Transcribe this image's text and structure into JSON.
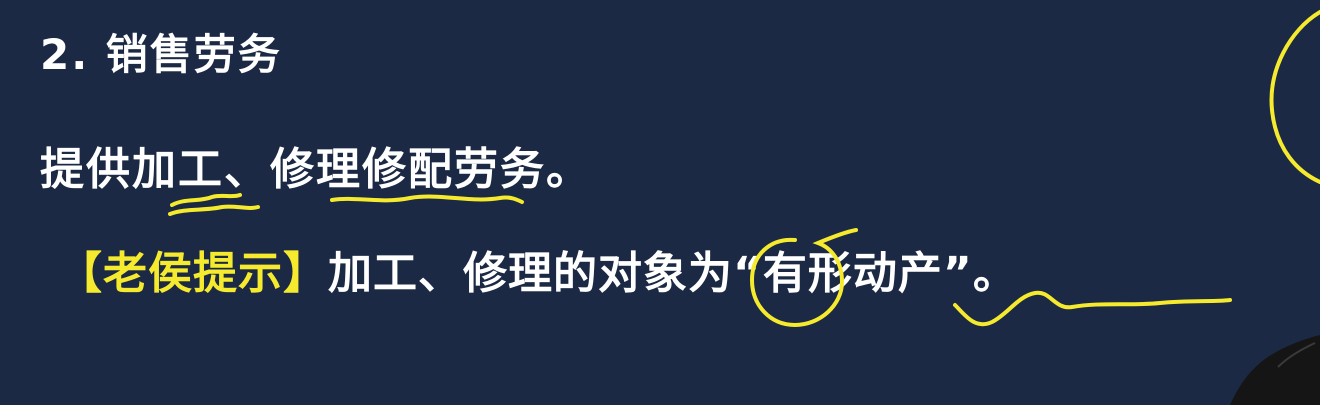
{
  "slide": {
    "heading": "2. 销售劳务",
    "line1": "提供加工、修理修配劳务。",
    "line2_tip": "【老侯提示】",
    "line2_body": "加工、修理的对象为“有形动产”。"
  },
  "colors": {
    "background": "#1b2944",
    "text": "#ffffff",
    "highlight": "#f5ea2e"
  }
}
